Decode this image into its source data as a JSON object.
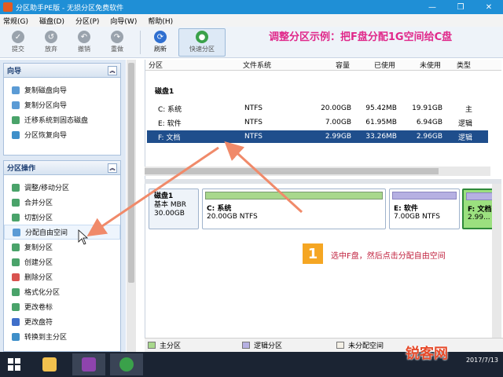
{
  "window": {
    "title": "分区助手PE版 - 无损分区免费软件",
    "controls": [
      "—",
      "❐",
      "✕"
    ]
  },
  "menu": [
    "常规(G)",
    "磁盘(D)",
    "分区(P)",
    "向导(W)",
    "帮助(H)"
  ],
  "toolbar": {
    "buttons": [
      {
        "label": "提交",
        "icon": "check-icon"
      },
      {
        "label": "放弃",
        "icon": "discard-icon"
      },
      {
        "label": "撤销",
        "icon": "undo-icon"
      },
      {
        "label": "重做",
        "icon": "redo-icon"
      },
      {
        "label": "刷新",
        "icon": "refresh-icon"
      },
      {
        "label": "快速分区",
        "icon": "quick-partition-icon"
      }
    ]
  },
  "banner": "调整分区示例：把F盘分配1G空间给C盘",
  "wizard_panel": {
    "title": "向导",
    "items": [
      "复制磁盘向导",
      "复制分区向导",
      "迁移系统到固态磁盘",
      "分区恢复向导"
    ]
  },
  "ops_panel": {
    "title": "分区操作",
    "items": [
      "调整/移动分区",
      "合并分区",
      "切割分区",
      "分配自由空间",
      "复制分区",
      "创建分区",
      "删除分区",
      "格式化分区",
      "更改卷标",
      "更改盘符",
      "转换到主分区"
    ]
  },
  "table": {
    "headers": [
      "分区",
      "文件系统",
      "容量",
      "已使用",
      "未使用",
      "类型"
    ],
    "disk_label": "磁盘1",
    "rows": [
      {
        "name": "C: 系统",
        "fs": "NTFS",
        "capacity": "20.00GB",
        "used": "95.42MB",
        "free": "19.91GB",
        "type": "主"
      },
      {
        "name": "E: 软件",
        "fs": "NTFS",
        "capacity": "7.00GB",
        "used": "61.95MB",
        "free": "6.94GB",
        "type": "逻辑"
      },
      {
        "name": "F: 文档",
        "fs": "NTFS",
        "capacity": "2.99GB",
        "used": "33.26MB",
        "free": "2.96GB",
        "type": "逻辑"
      }
    ]
  },
  "diskmap": {
    "disk_name": "磁盘1",
    "disk_type": "基本 MBR",
    "disk_size": "30.00GB",
    "partitions": [
      {
        "name": "C: 系统",
        "size": "20.00GB NTFS"
      },
      {
        "name": "E: 软件",
        "size": "7.00GB NTFS"
      },
      {
        "name": "F: 文档",
        "size": "2.99..."
      }
    ]
  },
  "legend": [
    "主分区",
    "逻辑分区",
    "未分配空间"
  ],
  "annotation": {
    "badge": "1",
    "text": "选中F盘，然后点击分配自由空间"
  },
  "watermark": "锐客网",
  "taskbar": {
    "time": "2017/7/13"
  },
  "colors": {
    "titlebar": "#1f8fd6",
    "banner": "#e0288a",
    "selected_row": "#1f4e8c",
    "primary_partition": "#a8d88c",
    "logical_partition": "#b6b0e2",
    "arrow": "#f08a6a"
  }
}
